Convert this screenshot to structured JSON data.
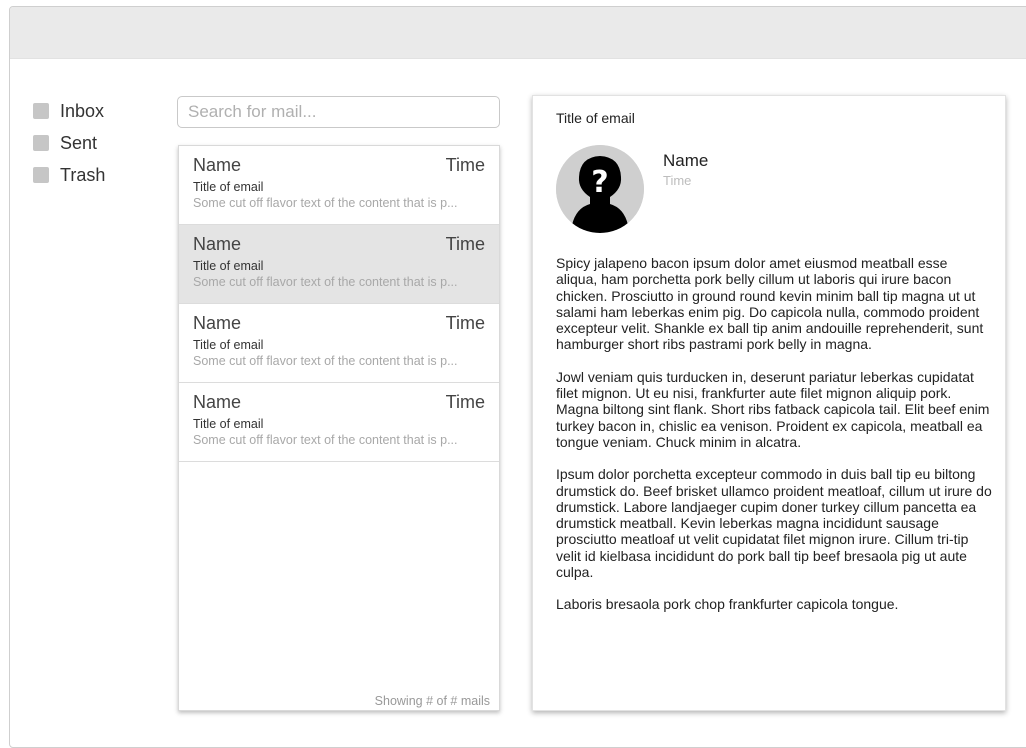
{
  "folders": [
    {
      "label": "Inbox"
    },
    {
      "label": "Sent"
    },
    {
      "label": "Trash"
    }
  ],
  "search": {
    "placeholder": "Search for mail..."
  },
  "mails": [
    {
      "name": "Name",
      "time": "Time",
      "subject": "Title of email",
      "preview": "Some cut off flavor text of the content that is p...",
      "selected": false
    },
    {
      "name": "Name",
      "time": "Time",
      "subject": "Title of email",
      "preview": "Some cut off flavor text of the content that is p...",
      "selected": true
    },
    {
      "name": "Name",
      "time": "Time",
      "subject": "Title of email",
      "preview": "Some cut off flavor text of the content that is p...",
      "selected": false
    },
    {
      "name": "Name",
      "time": "Time",
      "subject": "Title of email",
      "preview": "Some cut off flavor text of the content that is p...",
      "selected": false
    }
  ],
  "list_footer": "Showing # of # mails",
  "reader": {
    "title": "Title of email",
    "sender_name": "Name",
    "sender_time": "Time",
    "avatar_icon": "unknown-user-icon",
    "paragraphs": [
      "Spicy jalapeno bacon ipsum dolor amet eiusmod meatball esse aliqua, ham porchetta pork belly cillum ut laboris qui irure bacon chicken. Prosciutto in ground round kevin minim ball tip magna ut ut salami ham leberkas enim pig. Do capicola nulla, commodo proident excepteur velit. Shankle ex ball tip anim andouille reprehenderit, sunt hamburger short ribs pastrami pork belly in magna.",
      "Jowl veniam quis turducken in, deserunt pariatur leberkas cupidatat filet mignon. Ut eu nisi, frankfurter aute filet mignon aliquip pork. Magna biltong sint flank. Short ribs fatback capicola tail. Elit beef enim turkey bacon in, chislic ea venison. Proident ex capicola, meatball ea tongue veniam. Chuck minim in alcatra.",
      "Ipsum dolor porchetta excepteur commodo in duis ball tip eu biltong drumstick do. Beef brisket ullamco proident meatloaf, cillum ut irure do drumstick. Labore landjaeger cupim doner turkey cillum pancetta ea drumstick meatball. Kevin leberkas magna incididunt sausage prosciutto meatloaf ut velit cupidatat filet mignon irure. Cillum tri-tip velit id kielbasa incididunt do pork ball tip beef bresaola pig ut aute culpa.",
      "Laboris bresaola pork chop frankfurter capicola tongue."
    ]
  },
  "colors": {
    "topbar": "#eaeaea",
    "selected_row": "#e4e4e4",
    "folder_square": "#c6c6c6",
    "avatar_bg": "#cfcfcf"
  }
}
